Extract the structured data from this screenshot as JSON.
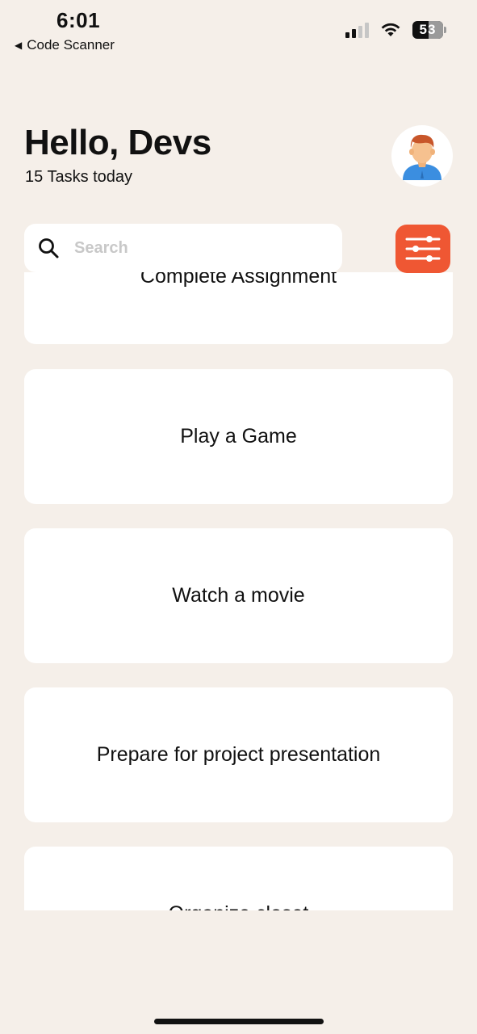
{
  "status_bar": {
    "time": "6:01",
    "back_label": "Code Scanner",
    "battery": "53",
    "battery_level_percent": 53,
    "signal_bars_filled": 2,
    "signal_bars_total": 4
  },
  "header": {
    "greeting": "Hello, Devs",
    "tasks_today": "15 Tasks today",
    "avatar_icon": "person-avatar-icon"
  },
  "search": {
    "placeholder": "Search",
    "value": "",
    "icon": "search-icon"
  },
  "filter": {
    "icon": "sliders-icon",
    "color": "#ef5733"
  },
  "tasks": [
    {
      "title": "Complete Assignment"
    },
    {
      "title": "Play a Game"
    },
    {
      "title": "Watch a movie"
    },
    {
      "title": "Prepare for project presentation"
    },
    {
      "title": "Organize closet"
    }
  ],
  "colors": {
    "background": "#f5efe9",
    "card": "#ffffff",
    "accent": "#ef5733"
  }
}
